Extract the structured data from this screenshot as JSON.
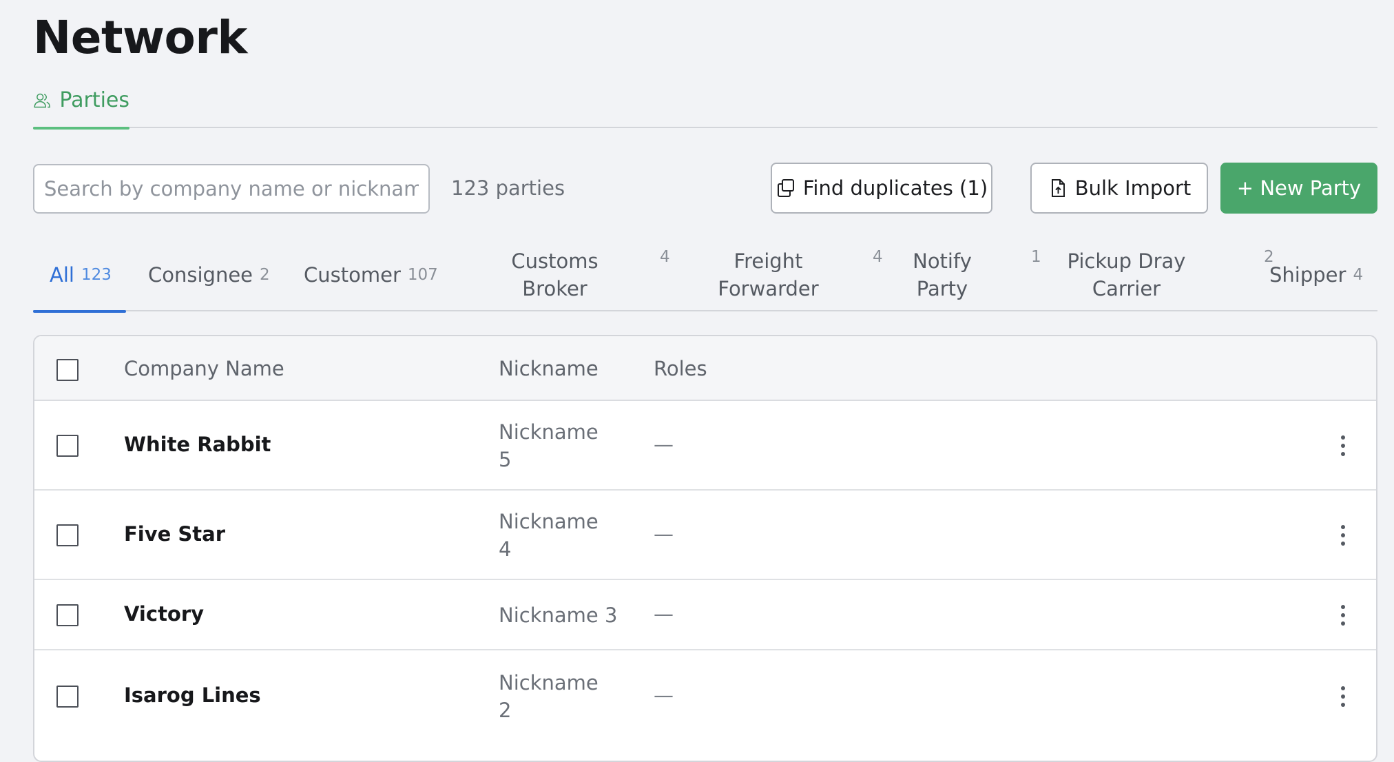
{
  "page": {
    "title": "Network"
  },
  "top_tabs": [
    {
      "label": "Parties",
      "icon": "users-icon",
      "active": true
    }
  ],
  "toolbar": {
    "search_placeholder": "Search by company name or nickname",
    "search_value": "",
    "count_label": "123 parties",
    "find_duplicates_label": "Find duplicates (1)",
    "bulk_import_label": "Bulk Import",
    "new_party_label": "+ New Party"
  },
  "role_tabs": [
    {
      "label": "All",
      "count": "123",
      "active": true
    },
    {
      "label": "Consignee",
      "count": "2"
    },
    {
      "label": "Customer",
      "count": "107"
    },
    {
      "label": "Customs Broker",
      "count": "4"
    },
    {
      "label": "Freight Forwarder",
      "count": "4"
    },
    {
      "label": "Notify Party",
      "count": "1"
    },
    {
      "label": "Pickup Dray Carrier",
      "count": "2"
    },
    {
      "label": "Shipper",
      "count": "4"
    }
  ],
  "table": {
    "columns": {
      "company": "Company Name",
      "nickname": "Nickname",
      "roles": "Roles"
    },
    "rows": [
      {
        "company": "White Rabbit",
        "nickname": "Nickname 5",
        "roles": "—"
      },
      {
        "company": "Five Star",
        "nickname": "Nickname 4",
        "roles": "—"
      },
      {
        "company": "Victory",
        "nickname": "Nickname 3",
        "roles": "—"
      },
      {
        "company": "Isarog Lines",
        "nickname": "Nickname 2",
        "roles": "—"
      }
    ]
  },
  "colors": {
    "accent_green": "#4aa66b",
    "tab_green": "#3f9c60",
    "accent_blue": "#2f6fd6",
    "background": "#f2f3f6"
  }
}
